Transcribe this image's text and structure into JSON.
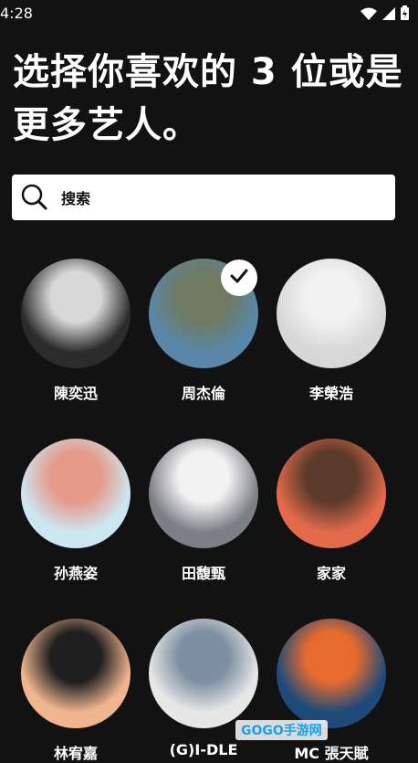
{
  "status_bar": {
    "time": "4:28"
  },
  "header": {
    "title": "选择你喜欢的 3 位或是更多艺人。"
  },
  "search": {
    "label": "搜索"
  },
  "artists": [
    {
      "name": "陳奕迅",
      "selected": false,
      "color_a": "#2b2b2b",
      "color_b": "#d8d8d8"
    },
    {
      "name": "周杰倫",
      "selected": true,
      "color_a": "#5a87a8",
      "color_b": "#6e7a62"
    },
    {
      "name": "李榮浩",
      "selected": false,
      "color_a": "#d7d7d7",
      "color_b": "#f2f2f2"
    },
    {
      "name": "孙燕姿",
      "selected": false,
      "color_a": "#cde7f2",
      "color_b": "#e59a8a"
    },
    {
      "name": "田馥甄",
      "selected": false,
      "color_a": "#7d7f86",
      "color_b": "#f2f2f2"
    },
    {
      "name": "家家",
      "selected": false,
      "color_a": "#e36a4b",
      "color_b": "#5a3a2a"
    },
    {
      "name": "林宥嘉",
      "selected": false,
      "color_a": "#f0b58e",
      "color_b": "#1f1f1f"
    },
    {
      "name": "(G)I-DLE",
      "selected": false,
      "color_a": "#e7e7e7",
      "color_b": "#7e8fa1"
    },
    {
      "name": "MC 張天賦",
      "selected": false,
      "color_a": "#1e4a7a",
      "color_b": "#e76b2f"
    }
  ],
  "watermark": {
    "text": "GOGO手游网"
  },
  "colors": {
    "background": "#121212",
    "text": "#ffffff",
    "search_bg": "#ffffff"
  }
}
